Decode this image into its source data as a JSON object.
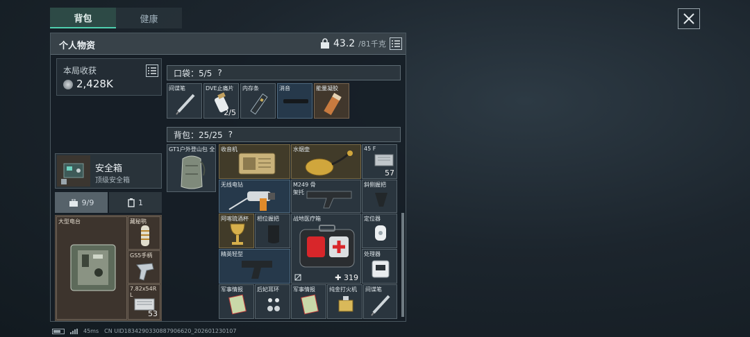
{
  "tabs": [
    {
      "label": "背包"
    },
    {
      "label": "健康"
    }
  ],
  "panel": {
    "title": "个人物资",
    "weight_current": "43.2",
    "weight_max": "/81千克"
  },
  "earnings": {
    "label": "本局收获",
    "value": "2,428K"
  },
  "safe_box": {
    "title": "安全箱",
    "subtitle": "顶级安全箱"
  },
  "container_tabs": [
    {
      "label": "9/9"
    },
    {
      "label": "1"
    }
  ],
  "container_items": [
    {
      "label": "大型电台",
      "count": ""
    },
    {
      "label": "藏秘鹗",
      "count": ""
    },
    {
      "label": "GS5手柄",
      "count": ""
    },
    {
      "label": "7.82x54R L",
      "count": "53"
    }
  ],
  "pocket": {
    "header": "口袋：5/5",
    "help": "?",
    "items": [
      {
        "label": "间谍笔",
        "count": ""
      },
      {
        "label": "DVE止痛片",
        "count": "2/5"
      },
      {
        "label": "内存条",
        "count": ""
      },
      {
        "label": "消音",
        "count": ""
      },
      {
        "label": "能量凝胶",
        "count": ""
      }
    ]
  },
  "backpack": {
    "header": "背包：25/25",
    "help": "?",
    "bag_label": "GT1户外登山包 全",
    "items": [
      {
        "label": "收音机",
        "count": ""
      },
      {
        "label": "水烟壶",
        "count": ""
      },
      {
        "label": "45 F",
        "count": "57"
      },
      {
        "label": "无线电钻",
        "count": ""
      },
      {
        "label": "M249 骨架托",
        "count": ""
      },
      {
        "label": "斜侧握把",
        "count": ""
      },
      {
        "label": "阿喀琉酒杯",
        "count": ""
      },
      {
        "label": "相位握把",
        "count": ""
      },
      {
        "label": "战地医疗箱",
        "count": "319"
      },
      {
        "label": "定位器",
        "count": ""
      },
      {
        "label": "精英轻型",
        "count": ""
      },
      {
        "label": "处理器",
        "count": ""
      },
      {
        "label": "军事情报",
        "count": ""
      },
      {
        "label": "后妃耳环",
        "count": ""
      },
      {
        "label": "军事情报",
        "count": ""
      },
      {
        "label": "纯金打火机",
        "count": ""
      },
      {
        "label": "间谍笔",
        "count": ""
      }
    ]
  },
  "status": {
    "ping": "45ms",
    "uid": "CN UID1834290330887906620_202601230107"
  },
  "colors": {
    "accent": "#4fd1b0",
    "container_bg": "#4a4138",
    "medkit_red": "#d8262a"
  }
}
